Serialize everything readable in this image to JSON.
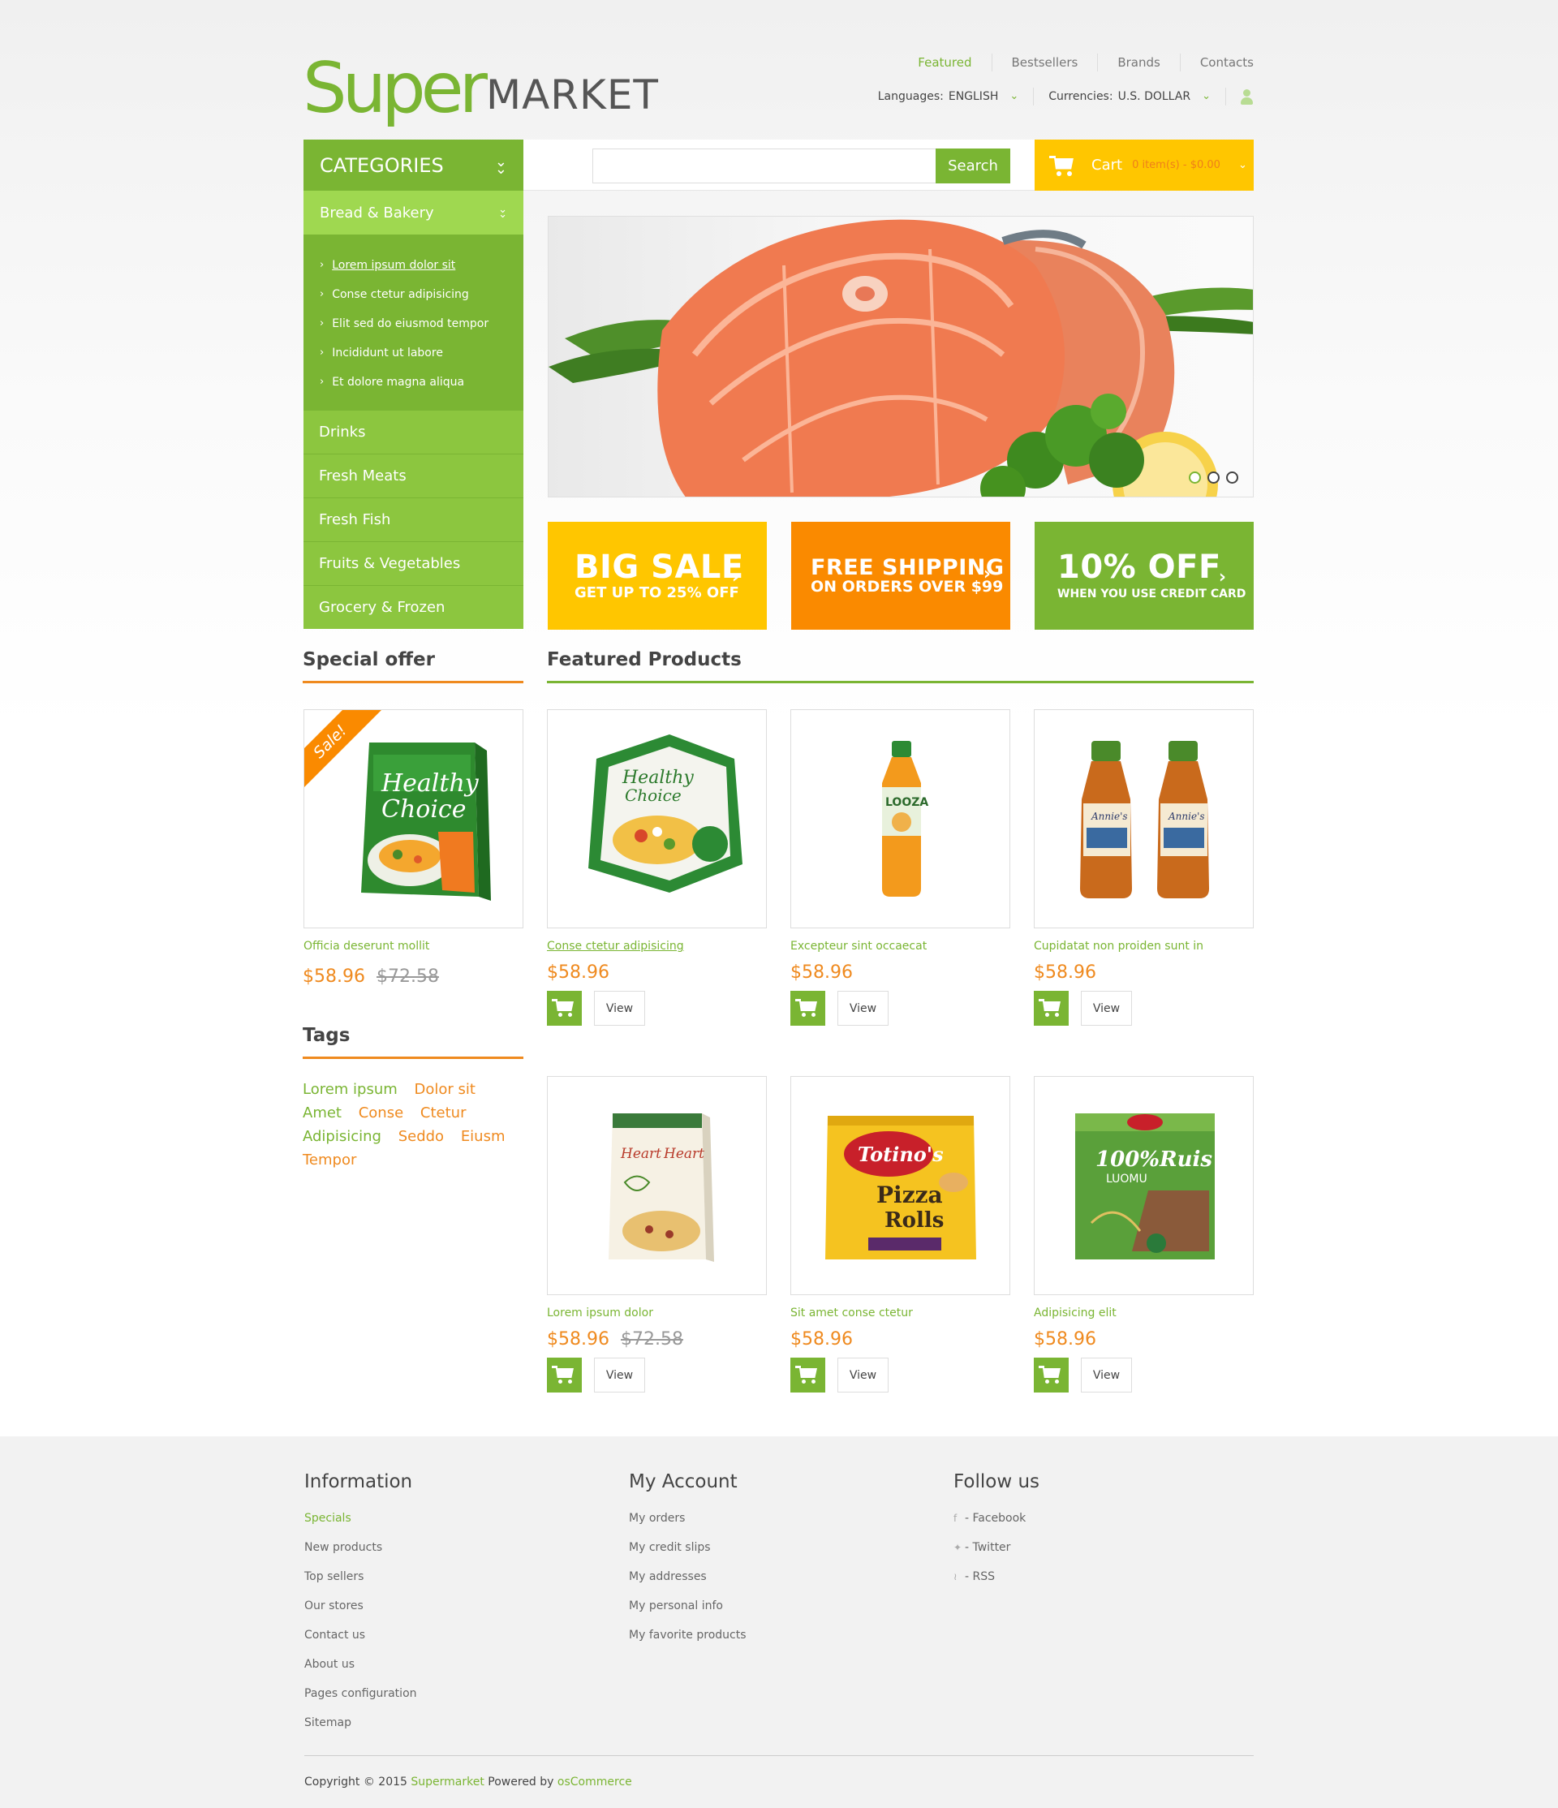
{
  "logo": {
    "part1": "Super",
    "part2": "MARKET"
  },
  "topnav": [
    "Featured",
    "Bestsellers",
    "Brands",
    "Contacts"
  ],
  "settings": {
    "languages_label": "Languages:",
    "languages_value": "ENGLISH",
    "currencies_label": "Currencies:",
    "currencies_value": "U.S. DOLLAR"
  },
  "categories": {
    "title": "CATEGORIES",
    "active": "Bread & Bakery",
    "subitems": [
      "Lorem ipsum dolor sit",
      "Conse ctetur adipisicing",
      "Elit sed do eiusmod tempor",
      "Incididunt ut labore",
      "Et dolore magna aliqua"
    ],
    "items": [
      "Drinks",
      "Fresh Meats",
      "Fresh Fish",
      "Fruits & Vegetables",
      "Grocery & Frozen"
    ]
  },
  "search": {
    "button": "Search",
    "placeholder": ""
  },
  "cart": {
    "label": "Cart",
    "info": "0 item(s) - $0.00"
  },
  "banners": [
    {
      "big": "BIG SALE",
      "small": "GET UP TO 25% OFF"
    },
    {
      "big": "FREE SHIPPING",
      "small": "ON ORDERS OVER $99"
    },
    {
      "big": "10% OFF",
      "small": "WHEN YOU USE CREDIT CARD"
    }
  ],
  "sections": {
    "special": "Special offer",
    "featured": "Featured Products",
    "tags": "Tags"
  },
  "special": {
    "sale_badge": "Sale!",
    "name": "Officia deserunt mollit",
    "price": "$58.96",
    "old_price": "$72.58"
  },
  "products": [
    {
      "name": "Conse ctetur adipisicing",
      "price": "$58.96",
      "old_price": ""
    },
    {
      "name": "Excepteur sint occaecat",
      "price": "$58.96",
      "old_price": ""
    },
    {
      "name": "Cupidatat non proiden sunt in",
      "price": "$58.96",
      "old_price": ""
    },
    {
      "name": "Lorem ipsum dolor",
      "price": "$58.96",
      "old_price": "$72.58"
    },
    {
      "name": "Sit amet conse ctetur",
      "price": "$58.96",
      "old_price": ""
    },
    {
      "name": "Adipisicing elit",
      "price": "$58.96",
      "old_price": ""
    }
  ],
  "view_label": "View",
  "tags": [
    "Lorem ipsum",
    "Dolor sit",
    "Amet",
    "Conse",
    "Ctetur",
    "Adipisicing",
    "Seddo",
    "Eiusm",
    "Tempor"
  ],
  "footer": {
    "information": {
      "title": "Information",
      "links": [
        "Specials",
        "New products",
        "Top sellers",
        "Our stores",
        "Contact us",
        "About us",
        "Pages configuration",
        "Sitemap"
      ]
    },
    "account": {
      "title": "My Account",
      "links": [
        "My orders",
        "My credit slips",
        "My addresses",
        "My personal info",
        "My favorite products"
      ]
    },
    "follow": {
      "title": "Follow us",
      "links": [
        "- Facebook",
        "- Twitter",
        "- RSS"
      ]
    },
    "copyright_prefix": "Copyright © 2015",
    "copyright_brand": "Supermarket",
    "copyright_mid": "Powered by",
    "copyright_platform": "osCommerce"
  },
  "colors": {
    "green": "#7ab533",
    "light_green": "#9fd850",
    "orange": "#fa8a00",
    "yellow": "#ffc600",
    "price_orange": "#ef8a1f"
  }
}
